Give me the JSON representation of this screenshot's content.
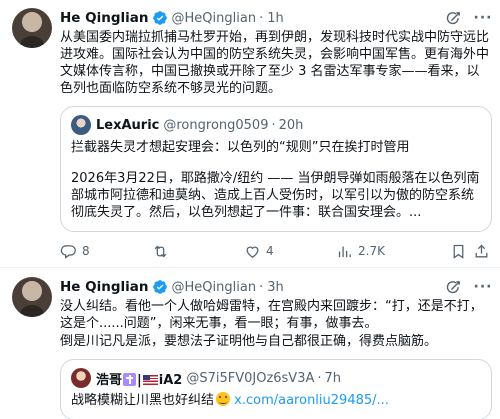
{
  "colors": {
    "accent": "#1d9bf0",
    "muted": "#536471",
    "border": "#cfd9de",
    "text": "#0f1419"
  },
  "tweets": [
    {
      "name": "He Qinglian",
      "handle": "@HeQinglian",
      "dot": "·",
      "time": "1h",
      "text": "从美国委内瑞拉抓捕马杜罗开始，再到伊朗，发现科技时代实战中防守远比进攻难。国际社会认为中国的防空系统失灵，会影响中国军售。更有海外中文媒体传言称，中国已撤换或开除了至少 3 名雷达军事专家——看来，以色列也面临防空系统不够灵光的问题。",
      "quote": {
        "name": "LexAuric",
        "handle": "@rongrong0509",
        "dot": "·",
        "time": "20h",
        "text1": "拦截器失灵才想起安理会：以色列的“规则”只在挨打时管用",
        "text2": "2026年3月22日，耶路撒冷/纽约 —— 当伊朗导弹如雨般落在以色列南部城市阿拉德和迪莫纳、造成上百人受伤时，以军引以为傲的防空系统彻底失灵了。然后，以色列想起了一件事：联合国安理会。..."
      },
      "actions": {
        "replies": "8",
        "retweets": "",
        "likes": "4",
        "views": "2.7K"
      },
      "icons": {
        "verified": "verified-badge-icon",
        "grok": "grok-icon",
        "more": "more-icon"
      }
    },
    {
      "name": "He Qinglian",
      "handle": "@HeQinglian",
      "dot": "·",
      "time": "3h",
      "text1": "没人纠结。看他一个人做哈姆雷特，在宫殿内来回踱步：“打，还是不打，这是个......问题”，闲来无事，看一眼；有事，做事去。",
      "text2": "倒是川记凡是派，要想法子证明他与自己都很正确，得费点脑筋。",
      "quote": {
        "name_prefix": "浩哥",
        "name_suffix": "iA2",
        "name_sep": "|",
        "handle": "@S7i5FV0JOz6sV3A",
        "dot": "·",
        "time": "7h",
        "text": "战略模糊让川黑也好纠结",
        "link": "x.com/aaronliu29485/..."
      }
    }
  ]
}
